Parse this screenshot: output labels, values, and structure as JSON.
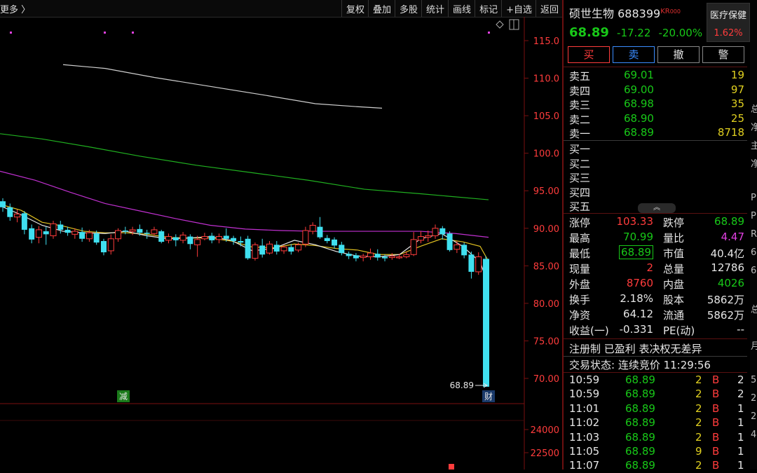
{
  "toolbar": {
    "more": "更多 〉",
    "buttons": [
      "复权",
      "叠加",
      "多股",
      "统计",
      "画线",
      "标记",
      "+自选",
      "返回"
    ]
  },
  "chart": {
    "price_axis": [
      "115.0",
      "110.0",
      "105.0",
      "100.0",
      "95.00",
      "90.00",
      "85.00",
      "80.00",
      "75.00",
      "70.00"
    ],
    "vol_axis": [
      "24000",
      "22500"
    ],
    "last_price_label": "68.89",
    "marker_reduce": "减",
    "marker_finance": "财",
    "colors": {
      "ma5": "#e6e6e6",
      "ma10": "#e0c020",
      "ma20": "#c030d0",
      "ma60": "#20b020",
      "ma120": "#cfcfcf",
      "up": "#ff3c3c",
      "down": "#40e0f0"
    }
  },
  "chart_data": {
    "type": "candlestick",
    "ylim": [
      65,
      117
    ],
    "candles": [
      [
        93.6,
        92.8,
        94.0,
        92.2
      ],
      [
        92.8,
        91.5,
        93.3,
        91.0
      ],
      [
        91.5,
        91.9,
        92.5,
        90.8
      ],
      [
        92.0,
        89.8,
        92.3,
        89.2
      ],
      [
        90.0,
        88.5,
        90.5,
        88.0
      ],
      [
        88.8,
        89.8,
        90.3,
        88.0
      ],
      [
        89.6,
        89.2,
        90.2,
        87.8
      ],
      [
        89.0,
        90.6,
        91.0,
        88.6
      ],
      [
        90.5,
        89.8,
        91.0,
        89.3
      ],
      [
        89.8,
        89.4,
        90.2,
        89.0
      ],
      [
        89.2,
        89.6,
        90.0,
        88.6
      ],
      [
        89.5,
        88.6,
        90.1,
        88.2
      ],
      [
        88.6,
        89.4,
        89.8,
        88.2
      ],
      [
        89.3,
        88.1,
        89.7,
        87.8
      ],
      [
        88.3,
        86.8,
        88.6,
        86.4
      ],
      [
        87.0,
        88.6,
        89.2,
        86.5
      ],
      [
        88.6,
        89.7,
        90.0,
        88.2
      ],
      [
        89.7,
        89.6,
        90.2,
        89.2
      ],
      [
        89.6,
        89.8,
        90.2,
        89.1
      ],
      [
        89.9,
        89.4,
        90.5,
        89.0
      ],
      [
        89.4,
        89.3,
        89.8,
        88.6
      ],
      [
        89.3,
        89.8,
        90.2,
        89.0
      ],
      [
        89.6,
        88.2,
        89.8,
        88.0
      ],
      [
        88.4,
        88.9,
        89.3,
        88.0
      ],
      [
        88.8,
        88.4,
        89.2,
        87.6
      ],
      [
        88.4,
        89.1,
        89.5,
        88.0
      ],
      [
        88.9,
        87.9,
        89.2,
        87.2
      ],
      [
        87.8,
        88.5,
        89.0,
        86.2
      ],
      [
        88.6,
        88.9,
        89.4,
        88.4
      ],
      [
        89.0,
        88.4,
        89.4,
        88.0
      ],
      [
        88.5,
        88.9,
        89.3,
        88.0
      ],
      [
        89.0,
        88.6,
        90.0,
        88.2
      ],
      [
        88.7,
        88.3,
        89.0,
        87.8
      ],
      [
        88.3,
        88.1,
        88.9,
        87.6
      ],
      [
        88.6,
        86.0,
        89.0,
        85.8
      ],
      [
        86.0,
        87.8,
        88.1,
        85.7
      ],
      [
        87.7,
        86.5,
        88.6,
        86.1
      ],
      [
        86.7,
        87.9,
        88.3,
        86.5
      ],
      [
        87.8,
        86.9,
        88.3,
        86.5
      ],
      [
        87.0,
        87.5,
        87.8,
        86.6
      ],
      [
        87.5,
        86.9,
        87.9,
        86.5
      ],
      [
        87.1,
        87.8,
        88.1,
        86.8
      ],
      [
        87.9,
        89.7,
        90.2,
        87.5
      ],
      [
        89.6,
        90.4,
        90.8,
        89.2
      ],
      [
        90.2,
        88.8,
        91.5,
        88.6
      ],
      [
        88.7,
        88.3,
        89.1,
        88.0
      ],
      [
        88.5,
        87.7,
        88.8,
        87.3
      ],
      [
        87.8,
        86.7,
        88.2,
        86.4
      ],
      [
        86.6,
        86.3,
        86.9,
        85.9
      ],
      [
        86.4,
        86.0,
        86.7,
        85.6
      ],
      [
        86.1,
        86.3,
        86.6,
        85.6
      ],
      [
        86.2,
        86.7,
        87.3,
        85.8
      ],
      [
        86.6,
        86.1,
        87.2,
        85.7
      ],
      [
        86.2,
        86.0,
        86.5,
        85.6
      ],
      [
        86.1,
        86.3,
        86.7,
        85.8
      ],
      [
        86.2,
        86.2,
        86.6,
        85.9
      ],
      [
        86.2,
        86.5,
        86.9,
        86.0
      ],
      [
        86.5,
        88.5,
        89.5,
        86.3
      ],
      [
        88.4,
        88.9,
        89.6,
        88.0
      ],
      [
        88.8,
        89.0,
        89.7,
        88.2
      ],
      [
        89.0,
        90.0,
        90.5,
        88.6
      ],
      [
        90.0,
        89.2,
        90.3,
        88.5
      ],
      [
        89.3,
        87.1,
        89.6,
        86.9
      ],
      [
        87.2,
        87.8,
        88.3,
        86.7
      ],
      [
        87.8,
        86.4,
        88.1,
        86.0
      ],
      [
        86.5,
        84.2,
        86.9,
        83.3
      ],
      [
        84.2,
        86.2,
        86.8,
        83.8
      ],
      [
        86.1,
        68.89,
        86.3,
        68.89
      ]
    ],
    "ma120": [
      [
        90,
        111.8
      ],
      [
        150,
        111.3
      ],
      [
        220,
        110.1
      ],
      [
        300,
        108.9
      ],
      [
        380,
        107.7
      ],
      [
        450,
        106.6
      ],
      [
        510,
        106.2
      ],
      [
        545,
        106.0
      ]
    ],
    "ma60": [
      [
        0,
        102.6
      ],
      [
        60,
        101.9
      ],
      [
        130,
        100.8
      ],
      [
        200,
        99.6
      ],
      [
        280,
        98.4
      ],
      [
        360,
        97.4
      ],
      [
        440,
        96.4
      ],
      [
        520,
        95.2
      ],
      [
        600,
        94.6
      ],
      [
        697,
        93.8
      ]
    ],
    "ma20": [
      [
        0,
        97.6
      ],
      [
        50,
        96.4
      ],
      [
        100,
        94.8
      ],
      [
        150,
        93.3
      ],
      [
        200,
        92.3
      ],
      [
        250,
        91.3
      ],
      [
        300,
        90.4
      ],
      [
        350,
        89.9
      ],
      [
        400,
        89.7
      ],
      [
        450,
        89.6
      ],
      [
        500,
        89.6
      ],
      [
        550,
        89.6
      ],
      [
        600,
        89.6
      ],
      [
        650,
        89.3
      ],
      [
        697,
        88.8
      ]
    ],
    "ma10": [
      [
        0,
        93.2
      ],
      [
        30,
        92.4
      ],
      [
        60,
        90.8
      ],
      [
        90,
        90.3
      ],
      [
        120,
        89.6
      ],
      [
        150,
        89.4
      ],
      [
        180,
        89.4
      ],
      [
        210,
        89.2
      ],
      [
        240,
        88.8
      ],
      [
        270,
        88.7
      ],
      [
        300,
        88.7
      ],
      [
        330,
        88.3
      ],
      [
        360,
        87.5
      ],
      [
        390,
        87.4
      ],
      [
        420,
        87.9
      ],
      [
        450,
        87.7
      ],
      [
        480,
        87.3
      ],
      [
        510,
        87.1
      ],
      [
        540,
        86.5
      ],
      [
        570,
        86.5
      ],
      [
        600,
        87.6
      ],
      [
        630,
        88.6
      ],
      [
        660,
        88.2
      ],
      [
        685,
        87.6
      ],
      [
        697,
        85.6
      ]
    ],
    "ma5": [
      [
        0,
        93.0
      ],
      [
        30,
        91.8
      ],
      [
        60,
        90.4
      ],
      [
        90,
        89.6
      ],
      [
        120,
        89.4
      ],
      [
        150,
        89.3
      ],
      [
        180,
        89.6
      ],
      [
        210,
        89.0
      ],
      [
        240,
        88.6
      ],
      [
        270,
        88.7
      ],
      [
        300,
        88.9
      ],
      [
        330,
        88.4
      ],
      [
        360,
        87.0
      ],
      [
        390,
        87.3
      ],
      [
        420,
        88.4
      ],
      [
        450,
        87.8
      ],
      [
        480,
        86.9
      ],
      [
        510,
        86.3
      ],
      [
        540,
        86.2
      ],
      [
        570,
        86.5
      ],
      [
        600,
        88.6
      ],
      [
        630,
        89.3
      ],
      [
        660,
        87.6
      ],
      [
        685,
        85.5
      ],
      [
        697,
        82.4
      ]
    ]
  },
  "quote": {
    "name": "硕世生物",
    "code": "688399",
    "tag": "KR",
    "tag_num": "000",
    "price": "68.89",
    "change": "-17.22",
    "change_pct": "-20.00%",
    "sector_name": "医疗保健",
    "sector_pct": "1.62%",
    "buttons": {
      "buy": "买",
      "sell": "卖",
      "cancel": "撤",
      "alert": "警"
    }
  },
  "orderbook": {
    "asks": [
      {
        "label": "卖五",
        "price": "69.01",
        "vol": "19"
      },
      {
        "label": "卖四",
        "price": "69.00",
        "vol": "97"
      },
      {
        "label": "卖三",
        "price": "68.98",
        "vol": "35"
      },
      {
        "label": "卖二",
        "price": "68.90",
        "vol": "25"
      },
      {
        "label": "卖一",
        "price": "68.89",
        "vol": "8718"
      }
    ],
    "bids": [
      {
        "label": "买一",
        "price": "",
        "vol": ""
      },
      {
        "label": "买二",
        "price": "",
        "vol": ""
      },
      {
        "label": "买三",
        "price": "",
        "vol": ""
      },
      {
        "label": "买四",
        "price": "",
        "vol": ""
      },
      {
        "label": "买五",
        "price": "",
        "vol": ""
      }
    ],
    "collapse": "︽"
  },
  "stats": [
    {
      "l1": "涨停",
      "v1": "103.33",
      "c1": "red",
      "l2": "跌停",
      "v2": "68.89",
      "c2": "grn"
    },
    {
      "l1": "最高",
      "v1": "70.99",
      "c1": "grn",
      "l2": "量比",
      "v2": "4.47",
      "c2": "mag"
    },
    {
      "l1": "最低",
      "v1": "68.89",
      "c1": "grn",
      "l2": "市值",
      "v2": "40.4亿",
      "c2": "wht"
    },
    {
      "l1": "现量",
      "v1": "2",
      "c1": "red",
      "l2": "总量",
      "v2": "12786",
      "c2": "wht"
    },
    {
      "l1": "外盘",
      "v1": "8760",
      "c1": "red",
      "l2": "内盘",
      "v2": "4026",
      "c2": "grn"
    },
    {
      "l1": "换手",
      "v1": "2.18%",
      "c1": "wht",
      "l2": "股本",
      "v2": "5862万",
      "c2": "wht"
    },
    {
      "l1": "净资",
      "v1": "64.12",
      "c1": "wht",
      "l2": "流通",
      "v2": "5862万",
      "c2": "wht"
    },
    {
      "l1": "收益(一)",
      "v1": "-0.331",
      "c1": "wht",
      "l2": "PE(动)",
      "v2": "--",
      "c2": "wht"
    }
  ],
  "notes": {
    "line1": "注册制 已盈利 表决权无差异",
    "line2": "交易状态: 连续竞价 11:29:56"
  },
  "ticks": [
    {
      "time": "10:59",
      "price": "68.89",
      "vol": "2",
      "side": "B",
      "n": "2"
    },
    {
      "time": "10:59",
      "price": "68.89",
      "vol": "2",
      "side": "B",
      "n": "2"
    },
    {
      "time": "11:01",
      "price": "68.89",
      "vol": "2",
      "side": "B",
      "n": "1"
    },
    {
      "time": "11:02",
      "price": "68.89",
      "vol": "2",
      "side": "B",
      "n": "1"
    },
    {
      "time": "11:03",
      "price": "68.89",
      "vol": "2",
      "side": "B",
      "n": "1"
    },
    {
      "time": "11:05",
      "price": "68.89",
      "vol": "9",
      "side": "B",
      "n": "1"
    },
    {
      "time": "11:07",
      "price": "68.89",
      "vol": "2",
      "side": "B",
      "n": "1"
    }
  ],
  "edge_glyphs": [
    "总",
    "净",
    "主",
    "净",
    "",
    "P",
    "P",
    "R",
    "6",
    "6",
    "",
    "总",
    "",
    "月",
    "",
    "5",
    "2",
    "2",
    "4"
  ]
}
